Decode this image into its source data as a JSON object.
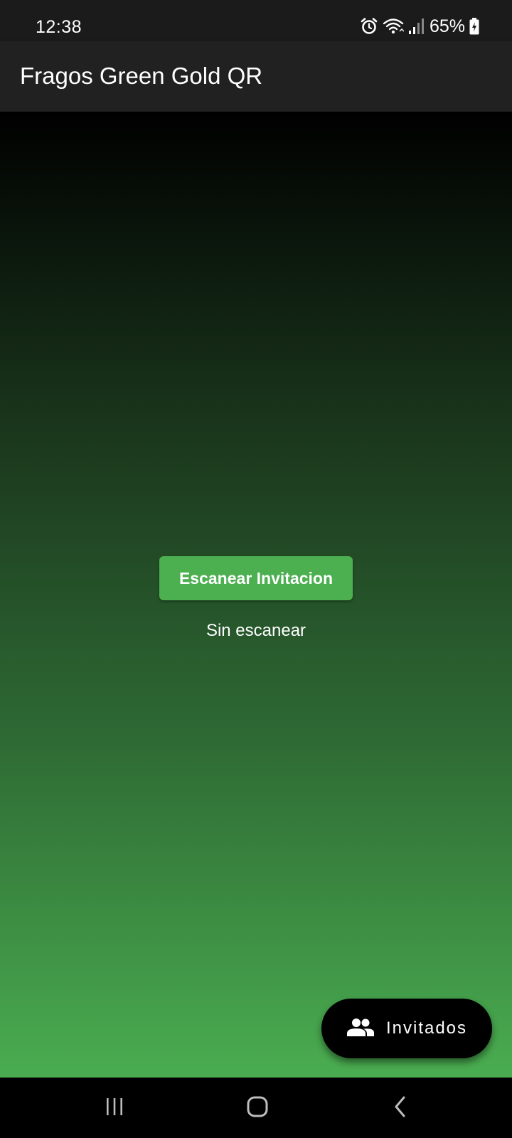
{
  "status_bar": {
    "time": "12:38",
    "battery": "65%",
    "icons": [
      "alarm-icon",
      "wifi-icon",
      "signal-icon",
      "battery-charging-icon"
    ]
  },
  "app_bar": {
    "title": "Fragos Green Gold QR"
  },
  "main": {
    "scan_button_label": "Escanear Invitacion",
    "scan_status": "Sin escanear"
  },
  "fab": {
    "label": "Invitados",
    "icon": "people-icon"
  },
  "nav_bar": {
    "icons": [
      "recent-apps-icon",
      "home-icon",
      "back-icon"
    ]
  },
  "colors": {
    "accent": "#4caf50",
    "app_bar": "#212121",
    "gradient_top": "#000000",
    "gradient_bottom": "#4aad50"
  }
}
